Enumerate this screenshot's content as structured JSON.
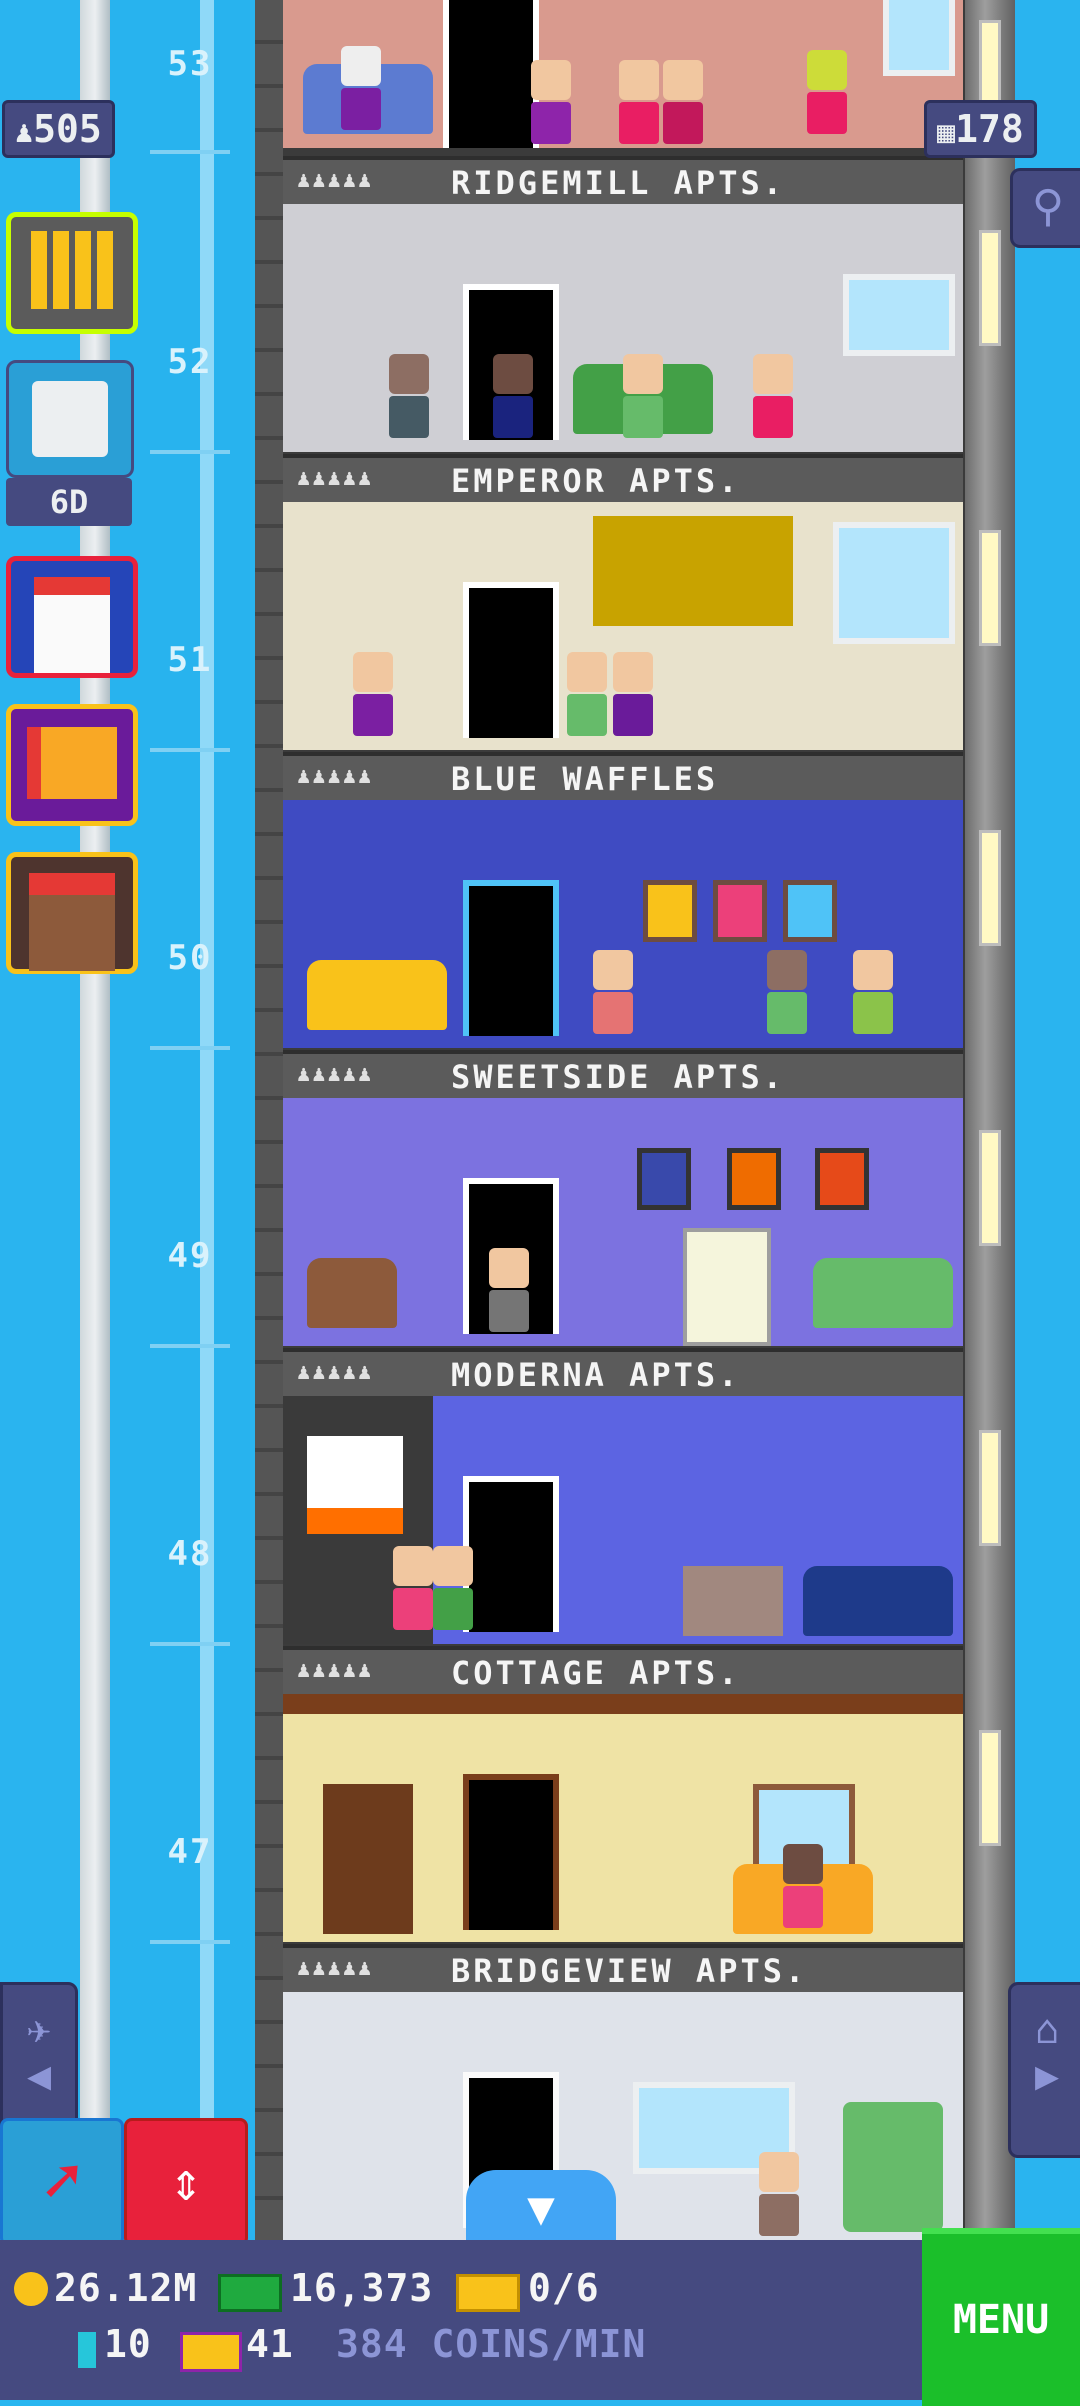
{
  "stats": {
    "population": "505",
    "floors": "178",
    "event_timer": "6D"
  },
  "elevator_floor_numbers": [
    "53",
    "52",
    "51",
    "50",
    "49",
    "48",
    "47"
  ],
  "floors": [
    {
      "name": "RIDGEMILL APTS.",
      "theme": "#d99a8e"
    },
    {
      "name": "EMPEROR APTS.",
      "theme": "#cfcfd4"
    },
    {
      "name": "BLUE WAFFLES",
      "theme": "#e8e2cc"
    },
    {
      "name": "SWEETSIDE APTS.",
      "theme": "#3f4bc2"
    },
    {
      "name": "MODERNA APTS.",
      "theme": "#7c72e0"
    },
    {
      "name": "COTTAGE APTS.",
      "theme": "#5c64e2"
    },
    {
      "name": "BRIDGEVIEW APTS.",
      "theme": "#efe3a5"
    }
  ],
  "resident_dots": "♟♟♟♟♟",
  "bottom": {
    "coins": "26.12M",
    "bux": "16,373",
    "tickets": "0/6",
    "keys": "10",
    "vip": "41",
    "rate": "384 COINS/MIN",
    "menu_label": "MENU"
  },
  "icons": {
    "population": "person-icon",
    "floors": "building-icon",
    "search": "magnifier-icon",
    "build": "grid-building-icon",
    "missions": "clipboard-icon",
    "calendar": "calendar-icon",
    "gift": "gift-icon",
    "shop": "market-stall-icon",
    "up_left": "airplane-icon",
    "right": "house-icon",
    "rocket": "rocket-icon",
    "elevator": "up-down-arrows-icon",
    "down": "down-arrow-icon"
  },
  "colors": {
    "sky": "#2ab4ef",
    "panel": "#454a80",
    "menu": "#1bbf2a",
    "elevator_red": "#e8213b"
  }
}
